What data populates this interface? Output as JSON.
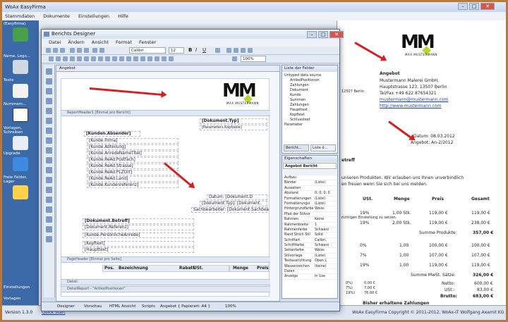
{
  "back_app": {
    "title": "WoAx EasyFirma",
    "menu": [
      "Stammdaten",
      "Dokumente",
      "Einstellungen",
      "Hilfe"
    ],
    "sidebar": [
      {
        "label": "(Easyfirma)"
      },
      {
        "label": "Name, Logo..."
      },
      {
        "label": "Texte"
      },
      {
        "label": "Nummern..."
      },
      {
        "label": "Vorlagen, Schreiben"
      },
      {
        "label": "Upgrade"
      },
      {
        "label": "Freie Felder, Lager"
      },
      {
        "label": "Einstellungen"
      },
      {
        "label": "Vorlagen"
      }
    ],
    "version": "Version 1.3.0",
    "quick_start": "Quick Start",
    "copyright": "WoAx EasyFirma Copyright © 2011-2012, WoAx-IT Wolfgang Axamit KG"
  },
  "preview": {
    "company_name": "MM",
    "company_sub": "MAX MUSTERMANN",
    "sender_title": "Angebot",
    "sender_line1": "Mustermann Malerei GmbH,",
    "sender_line2": "Hauptstrasse 123, 13507 Berlin",
    "sender_line3": "Tel/Fax +49 622 87654321",
    "sender_email": "mustermann@mustermann.com",
    "sender_web": "http://www.mustermann.com",
    "addr_city": "12507 Berlin",
    "datum": "Datum: 08.03.2012",
    "angebot_nr": "Angebot: An-2/2012",
    "betreff": "etreff",
    "text1": "unseren Produkten. Wir erlauben uns Ihnen unverbindlich",
    "text2": "en freuen wenn Sie sich bei uns melden.",
    "col_ust": "USt.",
    "col_menge": "Menge",
    "col_preis": "Preis",
    "col_gesamt": "Gesamt",
    "rows": [
      {
        "ust": "19%",
        "menge": "1,00 Stk.",
        "preis": "119,00 €",
        "gesamt": "119,00 €"
      },
      {
        "ust": "19%",
        "menge": "2,00 Stk.",
        "preis": "119,00 €",
        "gesamt": "238,00 €"
      }
    ],
    "note": "richtigen Einstellung zu setzen.",
    "summe_produkte_label": "Summe Produkte:",
    "summe_produkte": "357,00 €",
    "rows2": [
      {
        "ust": "0%",
        "menge": "1,00",
        "preis": "100,00 €",
        "gesamt": "100,00 €"
      },
      {
        "ust": "7%",
        "menge": "1,00",
        "preis": "107,00 €",
        "gesamt": "107,00 €"
      },
      {
        "ust": "19%",
        "menge": "1,00",
        "preis": "119,00 €",
        "gesamt": "119,00 €"
      }
    ],
    "summe_mwst_label": "Summe MwSt. Sätze:",
    "summe_mwst": "326,00 €",
    "netto_label": "Netto:",
    "netto": "600,00 €",
    "ust_label": "USt.:",
    "ust": "83,00 €",
    "brutto_label": "Brutto:",
    "brutto": "683,00 €",
    "small_rows": [
      {
        "rate": "0%)",
        "v": "0,00 €"
      },
      {
        "rate": "7%)",
        "v": "7,00 €"
      },
      {
        "rate": "19%)",
        "v": "76,00 €"
      }
    ],
    "payments": "Bisher erhaltene Zahlungen"
  },
  "designer": {
    "title": "Berichts Designer",
    "menu": [
      "Datei",
      "Ändern",
      "Ansicht",
      "Format",
      "Fenster"
    ],
    "font_name": "Calibri",
    "font_size": "12",
    "zoom": "100%",
    "tab": "Angebot",
    "bands": {
      "report_header": "ReportHeader1 [Einmal pro Bericht]",
      "page_header": "PageHeader [Einmal pro Seite]",
      "detail": "Detail",
      "detail_report": "DetailReport - \"ArtikelPositionen\""
    },
    "fields": {
      "dok_typ": "[Dokument.Typ]",
      "kopf": "[Parameters.Kopfzeile]",
      "anrede": "[Kunden.Absender]",
      "firma": "[Kunde.Firma]",
      "abteilung": "[Kunde.Abteilung]",
      "anrede_titel": "[Kunde.AnredeNameTitel]",
      "postfach": "[Kunde.ReAd.Postfach]",
      "strasse": "[Kunde.ReAd.Strasse]",
      "plzort": "[Kunde.ReAd.PLZOrt]",
      "land": "[Kunde.ReAd.Land]",
      "kundenref": "[Kunde.Kundenreferenz]",
      "datum": "Datum: [Dokument.D",
      "typ2": "[Dokument.Typ]: [Dokument.",
      "sachbearbeiter": "Sachbearbeiter: [Dokument.Sachbea",
      "betreff": "[Dokument.Betreff]",
      "referenz": "[Dokument.Referenz]",
      "anrede2": "[Kunde.PersönlicheAnrede]",
      "kopftext": "[Kopftext]",
      "haupttext": "[Haupttext]"
    },
    "table_header": [
      "Pos.",
      "Bezeichnung",
      "Rabatt",
      "USt.",
      "Menge",
      "Preis"
    ],
    "status": [
      "Designer",
      "Vorschau",
      "HTML Ansicht",
      "Scripts",
      "Angebot { Papierart: A4 }"
    ],
    "status_zoom": "100%"
  },
  "field_list": {
    "title": "Liste der Felder",
    "root": "Untyped data source",
    "items": [
      "ArtikelPositionen",
      "Zahlungen",
      "Dokument",
      "Kunde",
      "Summen",
      "Zahlungen",
      "Haupttext",
      "Kopftext",
      "Schlusstext"
    ],
    "parameters": "Parameter",
    "tab1": "Bericht...",
    "tab2": "Liste d..."
  },
  "properties": {
    "title": "Eigenschaften",
    "selected": "Angebot  Bericht",
    "rows": [
      {
        "k": "Aufbau",
        "v": ""
      },
      {
        "k": "Bänder",
        "v": "(Liste)"
      },
      {
        "k": "Aussehen",
        "v": ""
      },
      {
        "k": "Abstand",
        "v": "0; 0; 0; 0"
      },
      {
        "k": "Formatierungen",
        "v": "(Liste)"
      },
      {
        "k": "Formatierungsr",
        "v": "(Liste)"
      },
      {
        "k": "Hintergrundfarbe",
        "v": "Weiss"
      },
      {
        "k": "Pfad der Stilvor",
        "v": ""
      },
      {
        "k": "Rahmen",
        "v": "Keine"
      },
      {
        "k": "Rahmenbreite",
        "v": "1"
      },
      {
        "k": "Rahmenfarbe",
        "v": "Schwarz"
      },
      {
        "k": "Rand Strich Stil",
        "v": "Solid"
      },
      {
        "k": "Schriftart",
        "v": "Calibri,"
      },
      {
        "k": "Schriftfarbe",
        "v": "Schwarz"
      },
      {
        "k": "Seitenfarbe",
        "v": "Weiss"
      },
      {
        "k": "Stilvorlage",
        "v": "(Liste)"
      },
      {
        "k": "Textausrichtung",
        "v": "Oben L"
      },
      {
        "k": "Wasserzeichen",
        "v": "(keine)"
      },
      {
        "k": "Daten",
        "v": ""
      },
      {
        "k": "Anzeige",
        "v": "In Use"
      }
    ]
  },
  "back_dropdown": "▾"
}
